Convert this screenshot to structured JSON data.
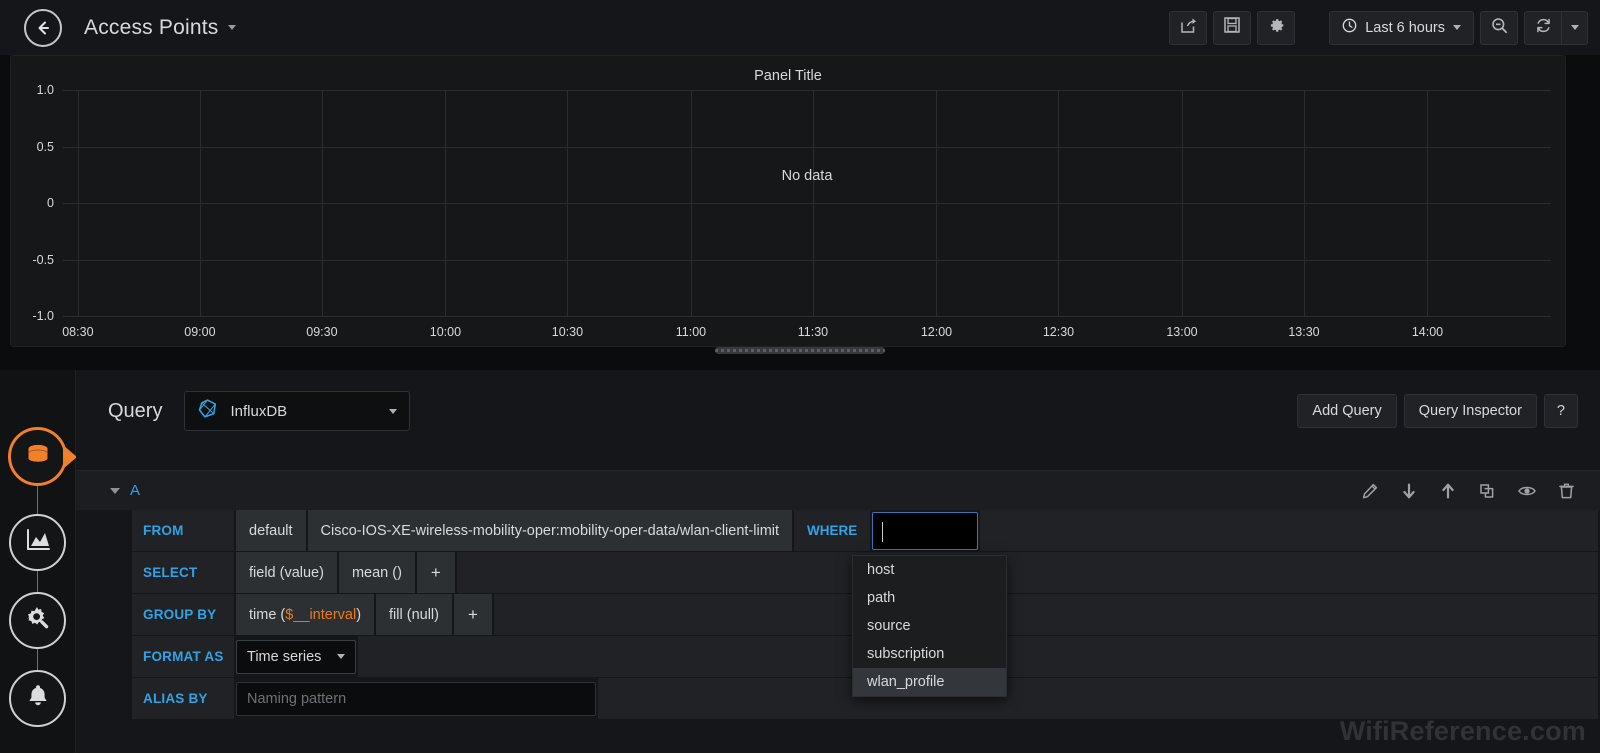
{
  "topnav": {
    "back_icon": "arrow-left-circle-icon",
    "dashboard_title": "Access Points",
    "share_icon": "share-icon",
    "save_icon": "save-icon",
    "settings_icon": "gear-icon",
    "clock_icon": "clock-icon",
    "time_range": "Last 6 hours",
    "zoom_out_icon": "search-minus-icon",
    "refresh_icon": "refresh-icon",
    "refresh_caret_icon": "chevron-down-icon"
  },
  "panel": {
    "title": "Panel Title",
    "no_data": "No data",
    "drag_handle": "panel-resize-handle"
  },
  "chart_data": {
    "type": "line",
    "title": "Panel Title",
    "xlabel": "",
    "ylabel": "",
    "series": [],
    "empty_message": "No data",
    "x_ticks": [
      "08:30",
      "09:00",
      "09:30",
      "10:00",
      "10:30",
      "11:00",
      "11:30",
      "12:00",
      "12:30",
      "13:00",
      "13:30",
      "14:00"
    ],
    "y_ticks": [
      "1.0",
      "0.5",
      "0",
      "-0.5",
      "-1.0"
    ],
    "ylim": [
      -1.0,
      1.0
    ],
    "grid": true,
    "legend": "none"
  },
  "sidebar": {
    "items": [
      {
        "name": "queries-tab",
        "icon": "database-icon",
        "active": true
      },
      {
        "name": "viz-tab",
        "icon": "chart-area-icon",
        "active": false
      },
      {
        "name": "settings-tab",
        "icon": "gear-wrench-icon",
        "active": false
      },
      {
        "name": "alert-tab",
        "icon": "bell-icon",
        "active": false
      }
    ]
  },
  "query": {
    "label": "Query",
    "datasource": "InfluxDB",
    "datasource_icon": "influxdb-icon",
    "add_query": "Add Query",
    "query_inspector": "Query Inspector",
    "help": "?",
    "row_letter": "A",
    "row_actions": [
      {
        "name": "edit-query-icon",
        "icon": "pencil-icon"
      },
      {
        "name": "move-query-down-icon",
        "icon": "arrow-down-icon"
      },
      {
        "name": "move-query-up-icon",
        "icon": "arrow-up-icon"
      },
      {
        "name": "duplicate-query-icon",
        "icon": "copy-icon"
      },
      {
        "name": "toggle-query-icon",
        "icon": "eye-icon"
      },
      {
        "name": "remove-query-icon",
        "icon": "trash-icon"
      }
    ],
    "from": {
      "key": "FROM",
      "policy": "default",
      "measurement": "Cisco-IOS-XE-wireless-mobility-oper:mobility-oper-data/wlan-client-limit",
      "where_key": "WHERE",
      "where_value": ""
    },
    "select": {
      "key": "SELECT",
      "parts": [
        "field (value)",
        "mean ()"
      ],
      "add": "+"
    },
    "group_by": {
      "key": "GROUP BY",
      "time_prefix": "time (",
      "time_var": "$__interval",
      "time_suffix": ")",
      "fill": "fill (null)",
      "add": "+"
    },
    "format_as": {
      "key": "FORMAT AS",
      "value": "Time series"
    },
    "alias_by": {
      "key": "ALIAS BY",
      "placeholder": "Naming pattern",
      "value": ""
    }
  },
  "suggestions": {
    "items": [
      "host",
      "path",
      "source",
      "subscription",
      "wlan_profile"
    ],
    "selected": "wlan_profile"
  },
  "watermark": "WifiReference.com",
  "colors": {
    "accent_blue": "#33a2e5",
    "accent_orange": "#f2802a",
    "panel_bg": "#161719",
    "editor_bg": "#141619"
  }
}
